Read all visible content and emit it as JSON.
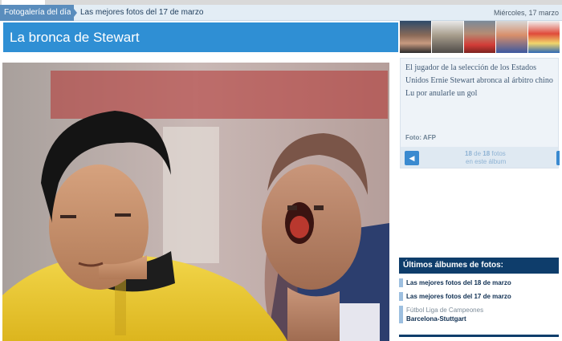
{
  "breadcrumb": {
    "section": "Fotogalería del día",
    "album": "Las mejores fotos del 17 de marzo",
    "date": "Miércoles, 17 marzo"
  },
  "title": "La bronca de Stewart",
  "caption": {
    "text": "El jugador de la selección de los Estados Unidos Ernie Stewart abronca al árbitro chino Lu por anularle un gol",
    "credit": "Foto: AFP"
  },
  "navigation": {
    "current": "18",
    "of_word": "de",
    "total": "18",
    "items_word": "fotos",
    "sub": "en este álbum",
    "prev_icon": "arrow-left-icon",
    "next_icon": "arrow-right-icon"
  },
  "latest_albums": {
    "heading": "Últimos álbumes de fotos:",
    "items": [
      {
        "title": "Las mejores fotos del 18 de marzo"
      },
      {
        "title": "Las mejores fotos del 17 de marzo"
      },
      {
        "category": "Fútbol Liga de Campeones",
        "title": "Barcelona-Stuttgart"
      }
    ]
  },
  "colors": {
    "title_bar": "#2f8fd4",
    "albums_header": "#0e3d6b",
    "breadcrumb_active": "#5a8dbd"
  }
}
